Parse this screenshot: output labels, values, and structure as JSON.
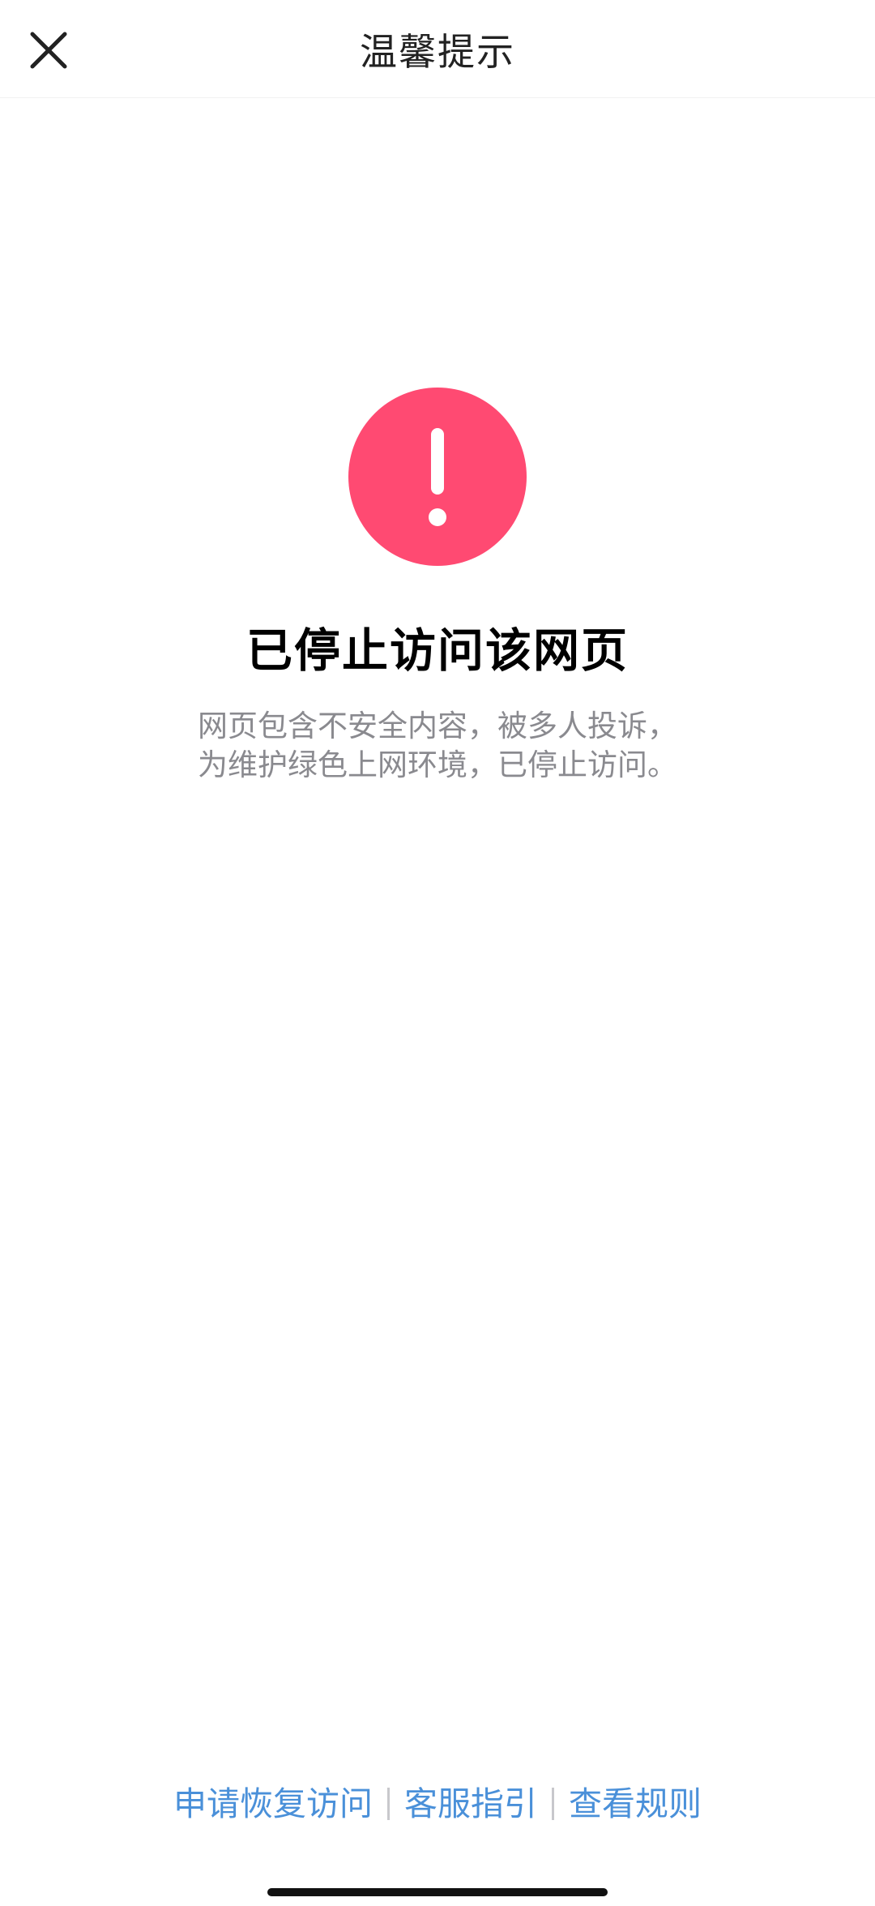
{
  "header": {
    "title": "温馨提示",
    "close_icon": "close-icon"
  },
  "main": {
    "icon": "exclamation-icon",
    "icon_color": "#ff4a72",
    "title": "已停止访问该网页",
    "description_lines": [
      "网页包含不安全内容，被多人投诉，",
      "为维护绿色上网环境，已停止访问。"
    ]
  },
  "footer": {
    "links": [
      "申请恢复访问",
      "客服指引",
      "查看规则"
    ],
    "link_color": "#4a90d9"
  }
}
